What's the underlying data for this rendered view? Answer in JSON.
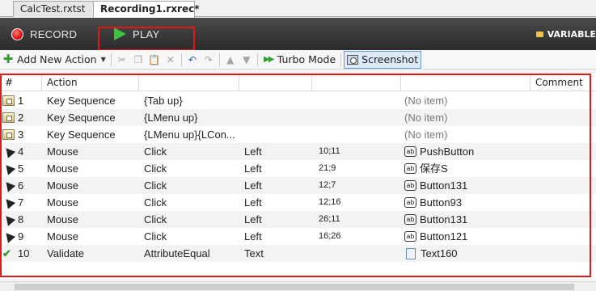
{
  "tabs": [
    {
      "label": "CalcTest.rxtst",
      "active": false
    },
    {
      "label": "Recording1.rxrec*",
      "active": true
    }
  ],
  "recorder": {
    "record_label": "RECORD",
    "play_label": "PLAY",
    "variables_label": "VARIABLE"
  },
  "toolbar": {
    "add_action_label": "Add New Action",
    "turbo_label": "Turbo Mode",
    "screenshot_label": "Screenshot"
  },
  "grid": {
    "headers": {
      "num": "#",
      "action": "Action",
      "comment": "Comment"
    },
    "rows": [
      {
        "num": "1",
        "icon": "key-sequence-icon",
        "action": "Key Sequence",
        "p1": "{Tab up}",
        "p2": "",
        "p3": "",
        "item": "(No item)",
        "item_icon": ""
      },
      {
        "num": "2",
        "icon": "key-sequence-icon",
        "action": "Key Sequence",
        "p1": "{LMenu up}",
        "p2": "",
        "p3": "",
        "item": "(No item)",
        "item_icon": ""
      },
      {
        "num": "3",
        "icon": "key-sequence-icon",
        "action": "Key Sequence",
        "p1": "{LMenu up}{LCon...",
        "p2": "",
        "p3": "",
        "item": "(No item)",
        "item_icon": ""
      },
      {
        "num": "4",
        "icon": "mouse-icon",
        "action": "Mouse",
        "p1": "Click",
        "p2": "Left",
        "p3": "10;11",
        "item": "PushButton",
        "item_icon": "button-icon"
      },
      {
        "num": "5",
        "icon": "mouse-icon",
        "action": "Mouse",
        "p1": "Click",
        "p2": "Left",
        "p3": "21;9",
        "item": "保存S",
        "item_icon": "button-icon"
      },
      {
        "num": "6",
        "icon": "mouse-icon",
        "action": "Mouse",
        "p1": "Click",
        "p2": "Left",
        "p3": "12;7",
        "item": "Button131",
        "item_icon": "button-icon"
      },
      {
        "num": "7",
        "icon": "mouse-icon",
        "action": "Mouse",
        "p1": "Click",
        "p2": "Left",
        "p3": "12;16",
        "item": "Button93",
        "item_icon": "button-icon"
      },
      {
        "num": "8",
        "icon": "mouse-icon",
        "action": "Mouse",
        "p1": "Click",
        "p2": "Left",
        "p3": "26;11",
        "item": "Button131",
        "item_icon": "button-icon"
      },
      {
        "num": "9",
        "icon": "mouse-icon",
        "action": "Mouse",
        "p1": "Click",
        "p2": "Left",
        "p3": "16;26",
        "item": "Button121",
        "item_icon": "button-icon"
      },
      {
        "num": "10",
        "icon": "validate-icon",
        "action": "Validate",
        "p1": "AttributeEqual",
        "p2": "Text",
        "p3": "",
        "item": "Text160",
        "item_icon": "text-icon"
      }
    ]
  },
  "button_icon_glyph": "ab"
}
